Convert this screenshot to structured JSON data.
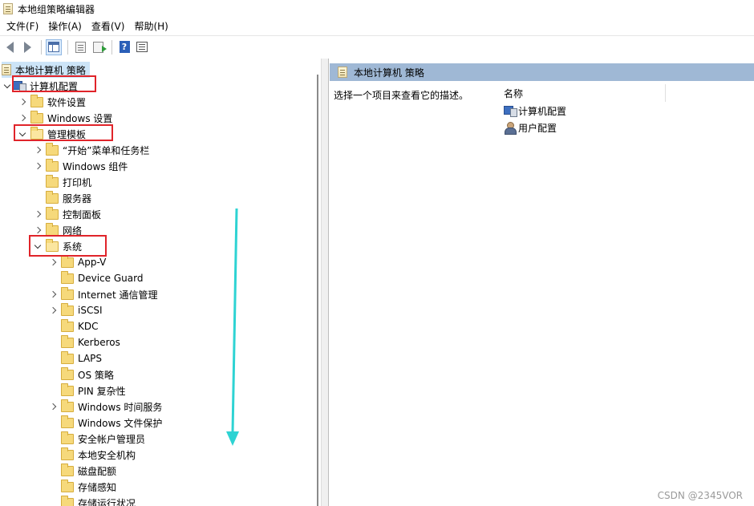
{
  "window": {
    "title": "本地组策略编辑器"
  },
  "menu": [
    "文件(F)",
    "操作(A)",
    "查看(V)",
    "帮助(H)"
  ],
  "tree": {
    "root": "本地计算机 策略",
    "computer_config": "计算机配置",
    "software_settings": "软件设置",
    "windows_settings": "Windows 设置",
    "admin_templates": "管理模板",
    "start_menu": "“开始”菜单和任务栏",
    "windows_components": "Windows 组件",
    "printer": "打印机",
    "server": "服务器",
    "control_panel": "控制面板",
    "network": "网络",
    "system": "系统",
    "system_children": [
      "App-V",
      "Device Guard",
      "Internet 通信管理",
      "iSCSI",
      "KDC",
      "Kerberos",
      "LAPS",
      "OS 策略",
      "PIN 复杂性",
      "Windows 时间服务",
      "Windows 文件保护",
      "安全帐户管理员",
      "本地安全机构",
      "磁盘配额",
      "存储感知",
      "存储运行状况"
    ]
  },
  "right": {
    "header": "本地计算机 策略",
    "description": "选择一个项目来查看它的描述。",
    "column_name": "名称",
    "items": [
      "计算机配置",
      "用户配置"
    ]
  },
  "watermark": "CSDN @2345VOR",
  "colors": {
    "highlight_box": "#e0242a",
    "annotation_arrow": "#2ed3d3",
    "pane_header": "#9fb8d5"
  }
}
